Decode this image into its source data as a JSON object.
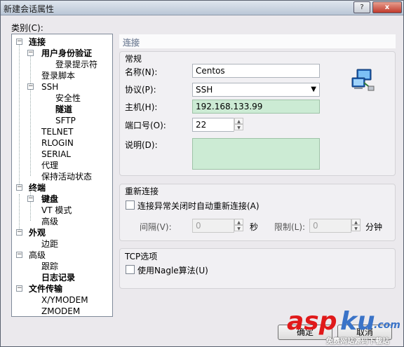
{
  "window": {
    "title": "新建会话属性",
    "help_label": "?",
    "close_label": "x"
  },
  "category_label": "类别(C):",
  "tree": {
    "connection": "连接",
    "user_auth": "用户身份验证",
    "login_prompt": "登录提示符",
    "login_script": "登录脚本",
    "ssh": "SSH",
    "security": "安全性",
    "tunnel": "隧道",
    "sftp": "SFTP",
    "telnet": "TELNET",
    "rlogin": "RLOGIN",
    "serial": "SERIAL",
    "proxy": "代理",
    "keepalive": "保持活动状态",
    "terminal": "终端",
    "keyboard": "键盘",
    "vt_mode": "VT 模式",
    "advanced": "高级",
    "appearance": "外观",
    "margin": "边距",
    "advanced2": "高级",
    "trace": "跟踪",
    "logging": "日志记录",
    "file_transfer": "文件传输",
    "xymodem": "X/YMODEM",
    "zmodem": "ZMODEM"
  },
  "panel_title": "连接",
  "general": {
    "title": "常规",
    "name_label": "名称(N):",
    "name_value": "Centos",
    "protocol_label": "协议(P):",
    "protocol_value": "SSH",
    "host_label": "主机(H):",
    "host_value": "192.168.133.99",
    "port_label": "端口号(O):",
    "port_value": "22",
    "desc_label": "说明(D):"
  },
  "reconnect": {
    "title": "重新连接",
    "auto_label": "连接异常关闭时自动重新连接(A)",
    "interval_label": "间隔(V):",
    "interval_value": "0",
    "seconds_label": "秒",
    "limit_label": "限制(L):",
    "limit_value": "0",
    "minutes_label": "分钟"
  },
  "tcp": {
    "title": "TCP选项",
    "nagle_label": "使用Nagle算法(U)"
  },
  "footer": {
    "ok_label": "确定",
    "cancel_label": "取消"
  },
  "watermark": {
    "brand_a": "asp",
    "brand_b": "ku",
    "brand_c": ".com",
    "tagline": "免费网站源码下载站"
  },
  "icons": {
    "network": "network-computers-icon"
  }
}
